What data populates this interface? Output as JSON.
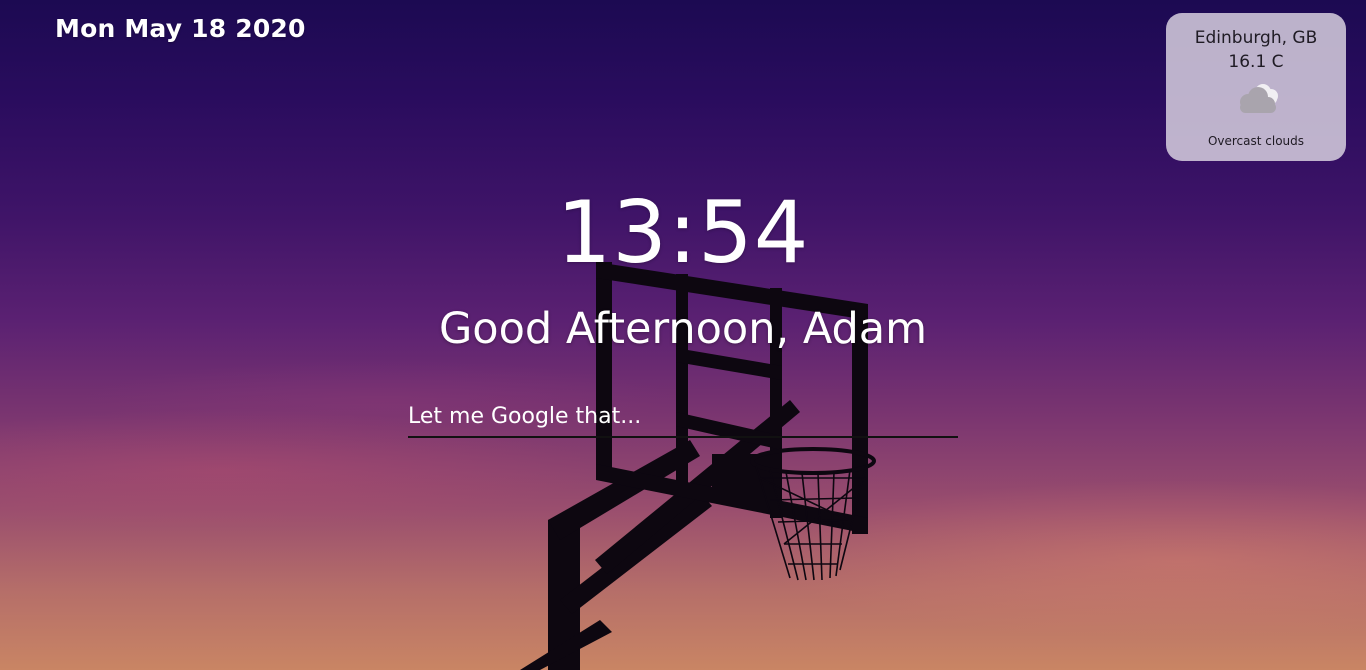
{
  "header": {
    "date": "Mon May 18 2020"
  },
  "weather": {
    "location": "Edinburgh, GB",
    "temperature": "16.1 C",
    "description": "Overcast clouds",
    "icon": "overcast-cloud-icon"
  },
  "main": {
    "time": "13:54",
    "greeting": "Good Afternoon, Adam"
  },
  "search": {
    "placeholder": "Let me Google that..."
  },
  "colors": {
    "text": "#ffffff",
    "weather_card_bg": "#d6cede",
    "search_underline": "#111111"
  }
}
